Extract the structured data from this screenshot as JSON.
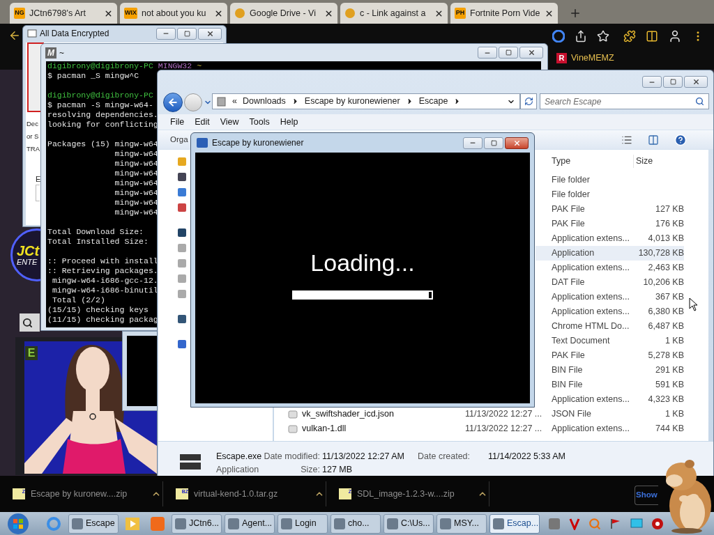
{
  "browser": {
    "tabs": [
      {
        "favicon_text": "NG",
        "title": "JCtn6798's Art"
      },
      {
        "favicon_text": "WIX",
        "title": "not about you ku"
      },
      {
        "title": "Google Drive - Vi"
      },
      {
        "title": "c - Link against a"
      },
      {
        "favicon_text": "PH",
        "title": "Fortnite Porn Vide"
      }
    ],
    "bookmark": {
      "icon_text": "R",
      "label": "VineMEMZ"
    }
  },
  "page": {
    "texts": [
      "Dec",
      "or S",
      "TRA"
    ],
    "field_label": "E",
    "logo_lines": [
      "JCt",
      "ENTE"
    ],
    "badge_text": "E"
  },
  "encrypted_window": {
    "title": "All Data Encrypted"
  },
  "terminal": {
    "icon_text": "M",
    "title": "~",
    "lines": [
      {
        "kind": "prompt",
        "user": "digibrony@digibrony-PC",
        "env": "MINGW32",
        "path": "~"
      },
      {
        "kind": "output",
        "text": "$ pacman _S mingw^C"
      },
      {
        "kind": "blank"
      },
      {
        "kind": "prompt",
        "user": "digibrony@digibrony-PC"
      },
      {
        "kind": "output",
        "text": "$ pacman -S mingw-w64-"
      },
      {
        "kind": "output",
        "text": "resolving dependencies."
      },
      {
        "kind": "output",
        "text": "looking for conflicting"
      },
      {
        "kind": "blank"
      },
      {
        "kind": "output",
        "text": "Packages (15) mingw-w64"
      },
      {
        "kind": "output",
        "text": "              mingw-w64"
      },
      {
        "kind": "output",
        "text": "              mingw-w64"
      },
      {
        "kind": "output",
        "text": "              mingw-w64"
      },
      {
        "kind": "output",
        "text": "              mingw-w64"
      },
      {
        "kind": "output",
        "text": "              mingw-w64"
      },
      {
        "kind": "output",
        "text": "              mingw-w64"
      },
      {
        "kind": "output",
        "text": "              mingw-w64"
      },
      {
        "kind": "blank"
      },
      {
        "kind": "output",
        "text": "Total Download Size:"
      },
      {
        "kind": "output",
        "text": "Total Installed Size:"
      },
      {
        "kind": "blank"
      },
      {
        "kind": "output",
        "text": ":: Proceed with install"
      },
      {
        "kind": "output",
        "text": ":: Retrieving packages."
      },
      {
        "kind": "output",
        "text": " mingw-w64-i686-gcc-12."
      },
      {
        "kind": "output",
        "text": " mingw-w64-i686-binutil"
      },
      {
        "kind": "output",
        "text": " Total (2/2)"
      },
      {
        "kind": "output",
        "text": "(15/15) checking keys"
      },
      {
        "kind": "output",
        "text": "(11/15) checking packag"
      }
    ]
  },
  "explorer": {
    "overflow_mark": "«",
    "breadcrumb": [
      "Downloads",
      "Escape by kuronewiener",
      "Escape"
    ],
    "search_placeholder": "Search Escape",
    "menu": [
      "File",
      "Edit",
      "View",
      "Tools",
      "Help"
    ],
    "toolbar_label": "Orga",
    "columns": [
      "Type",
      "Size"
    ],
    "rows": [
      {
        "type": "File folder",
        "selected": false
      },
      {
        "type": "File folder",
        "selected": false
      },
      {
        "type": "PAK File",
        "size": "127 KB",
        "selected": false
      },
      {
        "type": "PAK File",
        "size": "176 KB",
        "selected": false
      },
      {
        "type": "Application extens...",
        "size": "4,013 KB",
        "selected": false
      },
      {
        "type": "Application",
        "size": "130,728 KB",
        "selected": true
      },
      {
        "type": "Application extens...",
        "size": "2,463 KB",
        "selected": false
      },
      {
        "type": "DAT File",
        "size": "10,206 KB",
        "selected": false
      },
      {
        "type": "Application extens...",
        "size": "367 KB",
        "selected": false
      },
      {
        "type": "Application extens...",
        "size": "6,380 KB",
        "selected": false
      },
      {
        "type": "Chrome HTML Do...",
        "size": "6,487 KB",
        "selected": false
      },
      {
        "type": "Text Document",
        "size": "1 KB",
        "selected": false
      },
      {
        "type": "PAK File",
        "size": "5,278 KB",
        "selected": false
      },
      {
        "type": "BIN File",
        "size": "291 KB",
        "selected": false
      },
      {
        "type": "BIN File",
        "size": "591 KB",
        "selected": false
      },
      {
        "type": "Application extens...",
        "size": "4,323 KB",
        "selected": false
      },
      {
        "name": "vk_swiftshader_icd.json",
        "date": "11/13/2022 12:27 ...",
        "type": "JSON File",
        "size": "1 KB",
        "selected": false
      },
      {
        "name": "vulkan-1.dll",
        "date": "11/13/2022 12:27 ...",
        "type": "Application extens...",
        "size": "744 KB",
        "selected": false
      }
    ],
    "details": {
      "name": "Escape.exe",
      "kind_label": "Application",
      "modified_label": "Date modified:",
      "modified": "11/13/2022 12:27 AM",
      "size_label": "Size:",
      "size": "127 MB",
      "created_label": "Date created:",
      "created": "11/14/2022 5:33 AM"
    }
  },
  "game_window": {
    "title": "Escape by kuronewiener",
    "loading_text": "Loading...",
    "progress": {
      "level": 0.98
    }
  },
  "downloads": [
    {
      "name": "Escape by kuronew....zip",
      "icon_text": "Z"
    },
    {
      "name": "virtual-kend-1.0.tar.gz",
      "icon_text": "BZ"
    },
    {
      "name": "SDL_image-1.2.3-w....zip",
      "icon_text": "Z"
    }
  ],
  "show_button": "Show",
  "taskbar": [
    {
      "label": "Escape",
      "selected": false
    },
    {
      "label": "JCtn6...",
      "selected": false
    },
    {
      "label": "Agent...",
      "selected": false
    },
    {
      "label": "Login",
      "selected": false
    },
    {
      "label": "cho...",
      "selected": false
    },
    {
      "label": "C:\\Us...",
      "selected": false
    },
    {
      "label": "MSY...",
      "selected": false
    },
    {
      "label": "Escap...",
      "selected": true
    }
  ]
}
